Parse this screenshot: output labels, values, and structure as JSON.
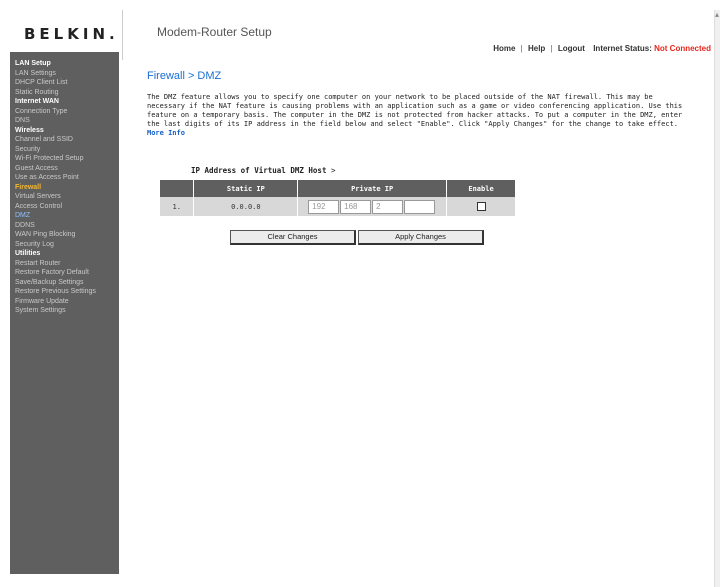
{
  "header": {
    "logo": "BELKIN.",
    "title": "Modem-Router Setup",
    "nav": {
      "home": "Home",
      "help": "Help",
      "logout": "Logout",
      "status_label": "Internet Status:",
      "status_value": "Not Connected",
      "sep": "|"
    },
    "colors": {
      "status": "#e8261c"
    }
  },
  "sidebar": {
    "items": [
      {
        "label": "LAN Setup",
        "kind": "head"
      },
      {
        "label": "LAN Settings",
        "kind": "link"
      },
      {
        "label": "DHCP Client List",
        "kind": "link"
      },
      {
        "label": "Static Routing",
        "kind": "link"
      },
      {
        "label": "Internet WAN",
        "kind": "head"
      },
      {
        "label": "Connection Type",
        "kind": "link"
      },
      {
        "label": "DNS",
        "kind": "link"
      },
      {
        "label": "Wireless",
        "kind": "head"
      },
      {
        "label": "Channel and SSID",
        "kind": "link"
      },
      {
        "label": "Security",
        "kind": "link"
      },
      {
        "label": "Wi-Fi Protected Setup",
        "kind": "link"
      },
      {
        "label": "Guest Access",
        "kind": "link"
      },
      {
        "label": "Use as Access Point",
        "kind": "link"
      },
      {
        "label": "Firewall",
        "kind": "active-head"
      },
      {
        "label": "Virtual Servers",
        "kind": "link"
      },
      {
        "label": "Access Control",
        "kind": "link"
      },
      {
        "label": "DMZ",
        "kind": "current"
      },
      {
        "label": "DDNS",
        "kind": "link"
      },
      {
        "label": "WAN Ping Blocking",
        "kind": "link"
      },
      {
        "label": "Security Log",
        "kind": "link"
      },
      {
        "label": "Utilities",
        "kind": "head"
      },
      {
        "label": "Restart Router",
        "kind": "link"
      },
      {
        "label": "Restore Factory Default",
        "kind": "link"
      },
      {
        "label": "Save/Backup Settings",
        "kind": "link"
      },
      {
        "label": "Restore Previous Settings",
        "kind": "link"
      },
      {
        "label": "Firmware Update",
        "kind": "link"
      },
      {
        "label": "System Settings",
        "kind": "link"
      }
    ]
  },
  "main": {
    "breadcrumb": "Firewall > DMZ",
    "description": "The DMZ feature allows you to specify one computer on your network to be placed outside of the NAT firewall. This may be necessary if the NAT feature is causing problems with an application such as a game or video conferencing application. Use this feature on a temporary basis. The computer in the DMZ is not protected from hacker attacks. To put a computer in the DMZ, enter the last digits of its IP address in the field below and select \"Enable\". Click \"Apply Changes\" for the change to take effect.",
    "more_info": "More Info",
    "virtual_host_label": "IP Address of Virtual DMZ Host",
    "virtual_host_arrow": ">",
    "table": {
      "headers": [
        "",
        "Static IP",
        "Private IP",
        "Enable"
      ],
      "rows": [
        {
          "index": "1.",
          "static_ip": "0.0.0.0",
          "private_ip": [
            "192",
            "168",
            "2",
            ""
          ],
          "enabled": false
        }
      ]
    },
    "buttons": {
      "clear": "Clear Changes",
      "apply": "Apply Changes"
    }
  }
}
